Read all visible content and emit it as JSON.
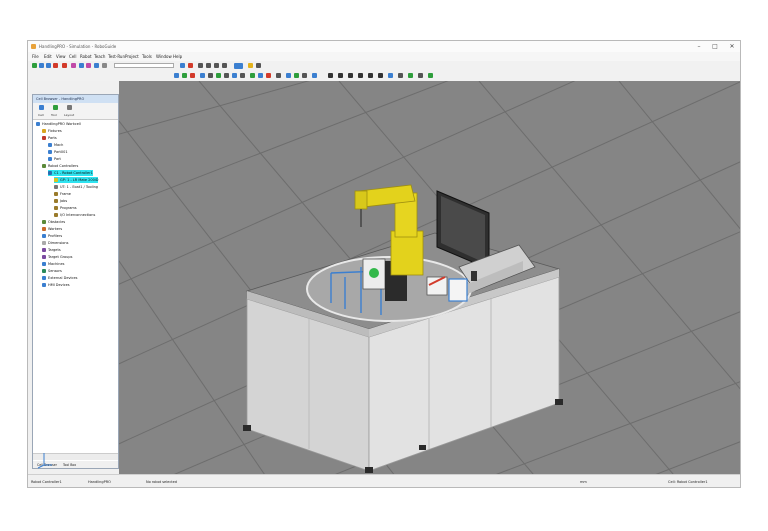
{
  "window": {
    "title": "HandlingPRO - Simulation - RoboGuide",
    "controls": [
      "–",
      "□",
      "✕"
    ]
  },
  "menu": [
    "File",
    "Edit",
    "View",
    "Cell",
    "Robot",
    "Teach",
    "Test-Run",
    "Project",
    "Tools",
    "Window",
    "Help"
  ],
  "panel": {
    "title": "Cell Browser - HandlingPRO",
    "tabs": [
      "Cell",
      "Tool",
      "Layout"
    ],
    "tree": [
      {
        "label": "HandlingPRO Workcell",
        "indent": 0,
        "color": "#3b7fd0"
      },
      {
        "label": "Fixtures",
        "indent": 1,
        "color": "#d9a51f"
      },
      {
        "label": "Parts",
        "indent": 1,
        "color": "#c03a2b"
      },
      {
        "label": "Mach",
        "indent": 2,
        "color": "#3b7fd0"
      },
      {
        "label": "Part001",
        "indent": 2,
        "color": "#3b7fd0"
      },
      {
        "label": "Part",
        "indent": 2,
        "color": "#3b7fd0"
      },
      {
        "label": "Robot Controllers",
        "indent": 1,
        "color": "#5b8a3a"
      },
      {
        "label": "C1 - Robot Controller1",
        "indent": 2,
        "color": "#2b6cb0",
        "highlight": true
      },
      {
        "label": "GP: 1 - LR Mate 200iD",
        "indent": 3,
        "color": "#d9c51f",
        "highlight": true
      },
      {
        "label": "UT: 1 - Eoat1 / Tooling",
        "indent": 3,
        "color": "#777777"
      },
      {
        "label": "Frame",
        "indent": 3,
        "color": "#9a7b2b"
      },
      {
        "label": "Jobs",
        "indent": 3,
        "color": "#9a7b2b"
      },
      {
        "label": "Programs",
        "indent": 3,
        "color": "#9a7b2b"
      },
      {
        "label": "I/O Interconnections",
        "indent": 3,
        "color": "#9a7b2b"
      },
      {
        "label": "Obstacles",
        "indent": 1,
        "color": "#5b8a3a"
      },
      {
        "label": "Workers",
        "indent": 1,
        "color": "#c96b2b"
      },
      {
        "label": "Profilers",
        "indent": 1,
        "color": "#3b7fd0"
      },
      {
        "label": "Dimensions",
        "indent": 1,
        "color": "#aaaaaa"
      },
      {
        "label": "Targets",
        "indent": 1,
        "color": "#7a4aa0"
      },
      {
        "label": "Target Groups",
        "indent": 1,
        "color": "#7a4aa0"
      },
      {
        "label": "Machines",
        "indent": 1,
        "color": "#3b7fd0"
      },
      {
        "label": "Sensors",
        "indent": 1,
        "color": "#2b8a5b"
      },
      {
        "label": "External Devices",
        "indent": 1,
        "color": "#3b7fd0"
      },
      {
        "label": "HMI Devices",
        "indent": 1,
        "color": "#3b7fd0"
      }
    ],
    "bottom_tabs": [
      "Cell Browser",
      "Tool Box"
    ]
  },
  "status": {
    "left": "Robot Controller1",
    "mode": "HandlingPRO",
    "message": "No robot selected",
    "right_left": "mm",
    "right_right": "Cell: Robot Controller1"
  },
  "colors": {
    "viewport": "#858585",
    "grid": "#6f6f6f",
    "robot": "#e3d21c",
    "table": "#d6d6d6",
    "tabletop": "#8e8e8e",
    "highlight": "#2fe3f0"
  },
  "icons": [
    "app-icon",
    "open-icon",
    "save-icon",
    "undo-icon",
    "redo-icon",
    "move-icon",
    "zoom-icon",
    "run-icon",
    "stop-icon",
    "settings-icon"
  ]
}
